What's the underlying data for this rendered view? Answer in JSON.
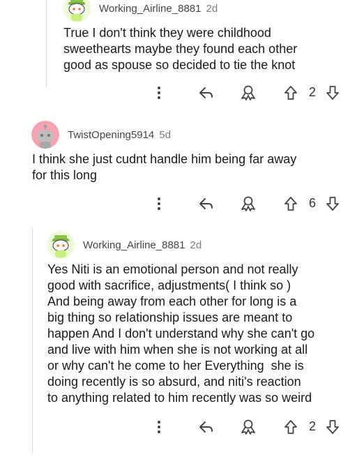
{
  "comments": [
    {
      "author": "Working_Airline_8881",
      "age": "2d",
      "body": "True I don't think they were childhood\nsweethearts maybe they found each other\ngood as spouse so decided to tie the knot",
      "score": "2",
      "avatar": "snoo-green"
    },
    {
      "author": "TwistOpening5914",
      "age": "5d",
      "body": "I think she just cudnt handle him being far away\nfor this long",
      "score": "6",
      "avatar": "snoo-gray"
    },
    {
      "author": "Working_Airline_8881",
      "age": "2d",
      "body": "Yes Niti is an emotional person and not really\ngood with sacrifice, adjustments( I think so )\nAnd being away from each other for long is a\nbig thing so relationship issues are meant to\nhappen And I don't understand why she can't go\nand live with him when she is not working at all\nor why can't he come to her Everything  she is\ndoing recently is so absurd, and niti's reaction\nto anything related to him recently was so weird",
      "score": "2",
      "avatar": "snoo-green"
    }
  ],
  "colors": {
    "icon": "#444444",
    "thread_line": "#dcdcdc",
    "avatar_green": "#c9ef7c",
    "avatar_pink": "#f4a3b3"
  },
  "icons": [
    "more-vertical-icon",
    "reply-icon",
    "award-icon",
    "upvote-icon",
    "downvote-icon"
  ]
}
